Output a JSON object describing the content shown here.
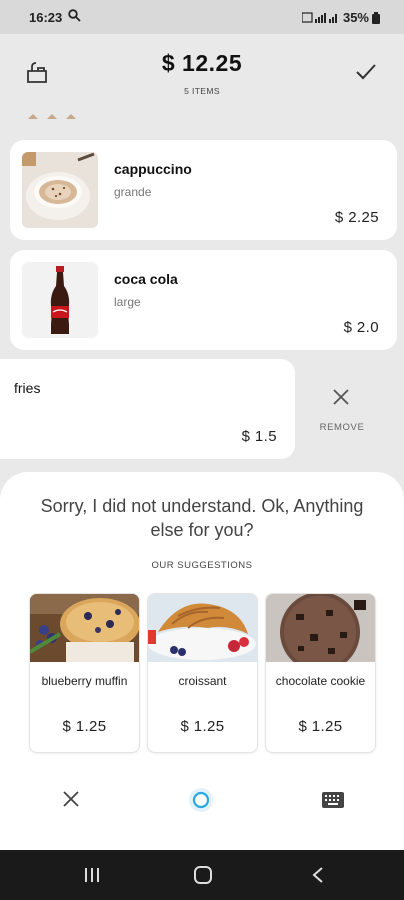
{
  "status_bar": {
    "time": "16:23",
    "battery": "35%"
  },
  "header": {
    "total": "$ 12.25",
    "item_count": "5 ITEMS"
  },
  "order_items": [
    {
      "name": "cappuccino",
      "size": "grande",
      "price": "$ 2.25",
      "image_icon": "cappuccino-image"
    },
    {
      "name": "coca cola",
      "size": "large",
      "price": "$ 2.0",
      "image_icon": "coca-cola-image"
    },
    {
      "name": "fries",
      "size": "",
      "price": "$ 1.5"
    }
  ],
  "remove": {
    "label": "REMOVE"
  },
  "assistant": {
    "message": "Sorry, I did not understand. Ok, Anything else for you?",
    "suggestions_title": "OUR SUGGESTIONS"
  },
  "suggestions": [
    {
      "name": "blueberry muffin",
      "price": "$ 1.25"
    },
    {
      "name": "croissant",
      "price": "$ 1.25"
    },
    {
      "name": "chocolate cookie",
      "price": "$ 1.25"
    }
  ],
  "colors": {
    "accent": "#29a8e0",
    "background": "#e9e9e9",
    "card": "#ffffff",
    "navbar": "#1a1a1a"
  }
}
